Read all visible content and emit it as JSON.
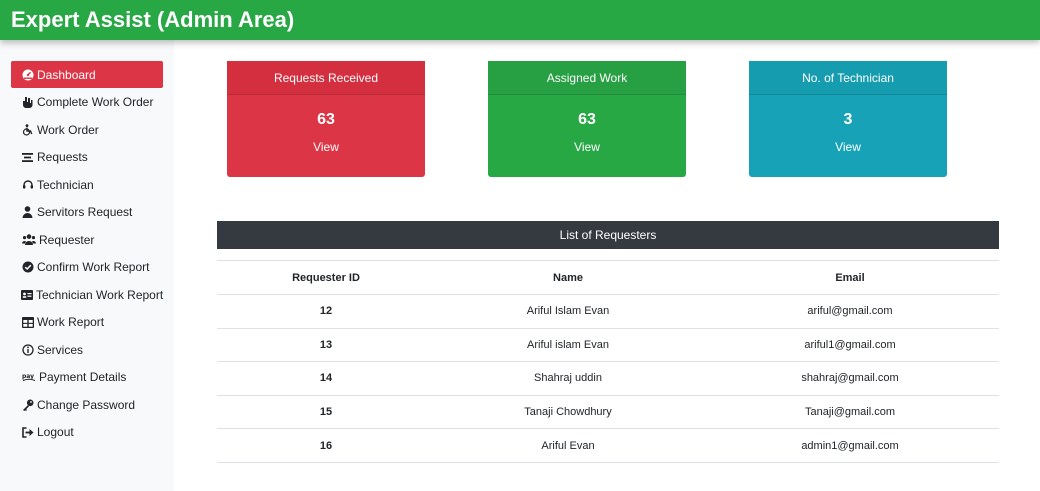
{
  "header": {
    "title": "Expert Assist (Admin Area)"
  },
  "sidebar": {
    "items": [
      {
        "label": "Dashboard",
        "icon": "dashboard-icon"
      },
      {
        "label": "Complete Work Order",
        "icon": "hand-icon"
      },
      {
        "label": "Work Order",
        "icon": "wheelchair-icon"
      },
      {
        "label": "Requests",
        "icon": "list-icon"
      },
      {
        "label": "Technician",
        "icon": "headset-icon"
      },
      {
        "label": "Servitors Request",
        "icon": "user-icon"
      },
      {
        "label": "Requester",
        "icon": "users-icon"
      },
      {
        "label": "Confirm Work Report",
        "icon": "check-circle-icon"
      },
      {
        "label": "Technician Work Report",
        "icon": "id-card-icon"
      },
      {
        "label": "Work Report",
        "icon": "table-icon"
      },
      {
        "label": "Services",
        "icon": "info-circle-icon"
      },
      {
        "label": "Payment Details",
        "icon": "payment-icon"
      },
      {
        "label": "Change Password",
        "icon": "key-icon"
      },
      {
        "label": "Logout",
        "icon": "sign-out-icon"
      }
    ]
  },
  "cards": [
    {
      "title": "Requests Received",
      "count": "63",
      "link": "View",
      "color": "#dc3545"
    },
    {
      "title": "Assigned Work",
      "count": "63",
      "link": "View",
      "color": "#28a745"
    },
    {
      "title": "No. of Technician",
      "count": "3",
      "link": "View",
      "color": "#17a2b8"
    }
  ],
  "requesters": {
    "title": "List of Requesters",
    "columns": [
      "Requester ID",
      "Name",
      "Email"
    ],
    "rows": [
      [
        "12",
        "Ariful Islam Evan",
        "ariful@gmail.com"
      ],
      [
        "13",
        "Ariful islam Evan",
        "ariful1@gmail.com"
      ],
      [
        "14",
        "Shahraj uddin",
        "shahraj@gmail.com"
      ],
      [
        "15",
        "Tanaji Chowdhury",
        "Tanaji@gmail.com"
      ],
      [
        "16",
        "Ariful Evan",
        "admin1@gmail.com"
      ]
    ]
  }
}
